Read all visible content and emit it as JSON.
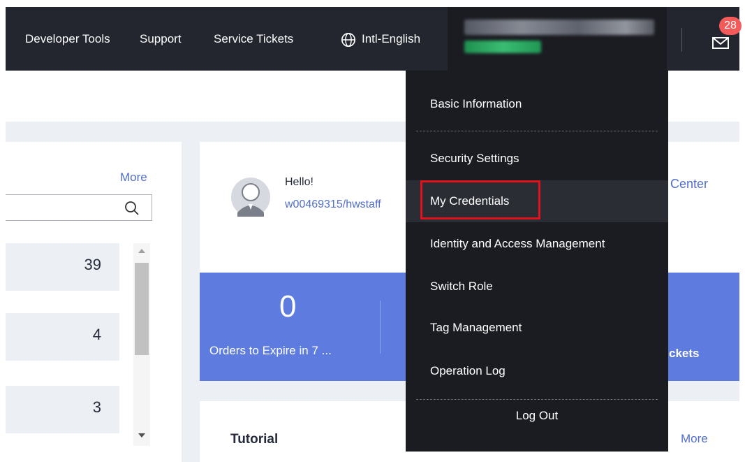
{
  "topnav": {
    "items": [
      "Developer Tools",
      "Support",
      "Service Tickets"
    ],
    "language": "Intl-English",
    "notification_count": "28"
  },
  "left_panel": {
    "more": "More",
    "counts": [
      "39",
      "4",
      "3"
    ]
  },
  "profile": {
    "greeting": "Hello!",
    "username": "w00469315/hwstaff",
    "center_link": "Center"
  },
  "stats": {
    "value": "0",
    "label": "Orders to Expire in 7 ...",
    "label2": "ckets"
  },
  "tutorial": {
    "title": "Tutorial",
    "more": "More"
  },
  "dropdown": {
    "items": [
      "Basic Information",
      "Security Settings",
      "My Credentials",
      "Identity and Access Management",
      "Switch Role",
      "Tag Management",
      "Operation Log"
    ],
    "logout": "Log Out",
    "highlight_color": "#e0131d"
  },
  "colors": {
    "topbar": "#23262f",
    "link": "#526ecc",
    "stats_bg": "#5e7ce0",
    "badge": "#f35b5b"
  }
}
